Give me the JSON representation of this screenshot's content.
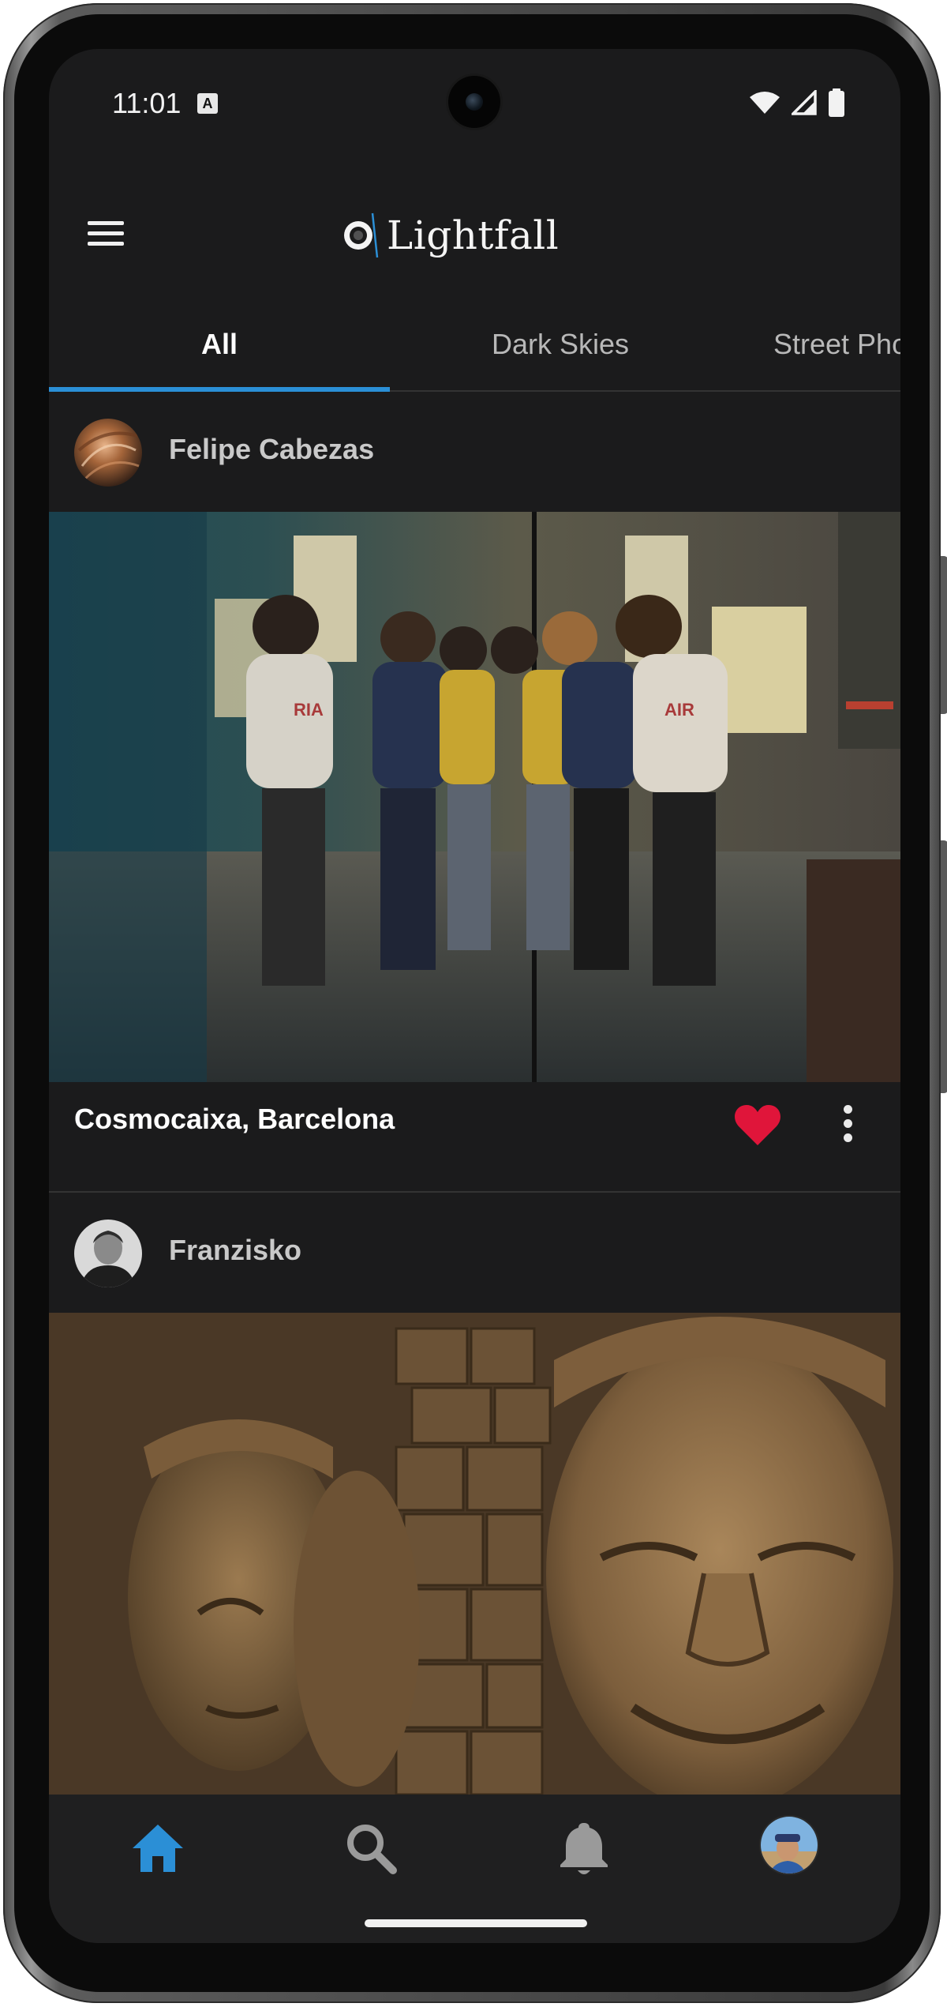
{
  "status_bar": {
    "time": "11:01",
    "notification_icon": "a-badge-icon",
    "notification_glyph": "A",
    "icons": [
      "wifi-icon",
      "signal-icon",
      "battery-icon"
    ]
  },
  "app_bar": {
    "menu_icon": "menu-icon",
    "brand_name": "Lightfall",
    "brand_logo": "lightfall-logo-icon"
  },
  "tabs": [
    {
      "label": "All",
      "active": true
    },
    {
      "label": "Dark Skies",
      "active": false
    },
    {
      "label": "Street Pho",
      "active": false
    }
  ],
  "posts": [
    {
      "author": "Felipe Cabezas",
      "photo": "museum-mirror-kids-photo",
      "caption": "Cosmocaixa, Barcelona",
      "liked": true
    },
    {
      "author": "Franzisko",
      "photo": "stone-faces-sculpture-photo",
      "caption": ""
    }
  ],
  "bottom_nav": {
    "items": [
      {
        "name": "home",
        "icon": "home-icon",
        "active": true
      },
      {
        "name": "search",
        "icon": "search-icon",
        "active": false
      },
      {
        "name": "notifications",
        "icon": "bell-icon",
        "active": false
      },
      {
        "name": "profile",
        "icon": "profile-avatar",
        "active": false
      }
    ]
  },
  "colors": {
    "background": "#1b1b1c",
    "accent": "#2b8fd6",
    "like": "#e0153a",
    "text_primary": "#ffffff",
    "text_secondary": "#c9c9c9"
  }
}
